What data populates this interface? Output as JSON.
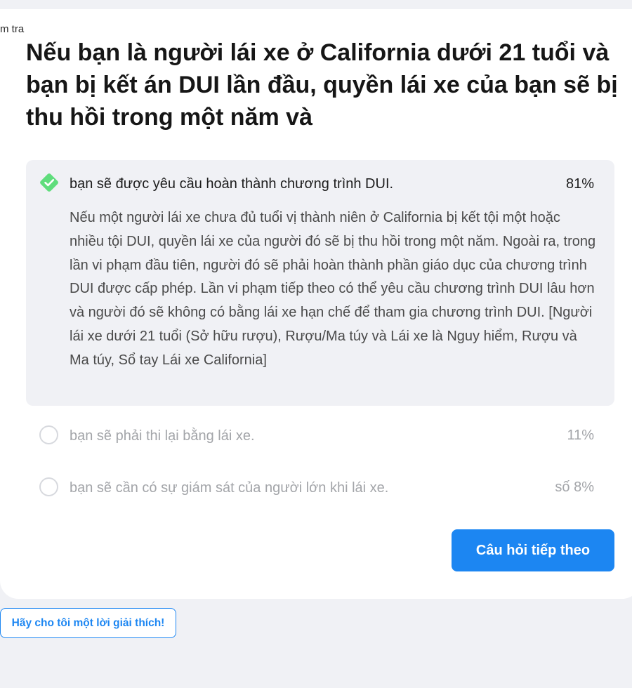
{
  "breadcrumb": "m tra",
  "question": "Nếu bạn là người lái xe ở California dưới 21 tuổi và bạn bị kết án DUI lần đầu, quyền lái xe của bạn sẽ bị thu hồi trong một năm và",
  "answers": [
    {
      "label": "bạn sẽ được yêu cầu hoàn thành chương trình DUI.",
      "percent": "81%",
      "state": "correct-selected",
      "explanation": "Nếu một người lái xe chưa đủ tuổi vị thành niên ở California bị kết tội một hoặc nhiều tội DUI, quyền lái xe của người đó sẽ bị thu hồi trong một năm. Ngoài ra, trong lần vi phạm đầu tiên, người đó sẽ phải hoàn thành phần giáo dục của chương trình DUI được cấp phép. Lần vi phạm tiếp theo có thể yêu cầu chương trình DUI lâu hơn và người đó sẽ không có bằng lái xe hạn chế để tham gia chương trình DUI. [Người lái xe dưới 21 tuổi (Sở hữu rượu), Rượu/Ma túy và Lái xe là Nguy hiểm, Rượu và Ma túy, Sổ tay Lái xe California]"
    },
    {
      "label": "bạn sẽ phải thi lại bằng lái xe.",
      "percent": "11%",
      "state": "unselected"
    },
    {
      "label": "bạn sẽ cần có sự giám sát của người lớn khi lái xe.",
      "percent": "số 8%",
      "state": "unselected"
    }
  ],
  "buttons": {
    "next": "Câu hỏi tiếp theo",
    "explain": "Hãy cho tôi một lời giải thích!"
  },
  "icons": {
    "correct": "check-diamond-icon",
    "unselected": "radio-circle-icon"
  },
  "colors": {
    "background": "#f0f1f5",
    "card": "#ffffff",
    "accent": "#1c86f2",
    "correct": "#5fdd7c",
    "muted_text": "#a3a5a9"
  }
}
